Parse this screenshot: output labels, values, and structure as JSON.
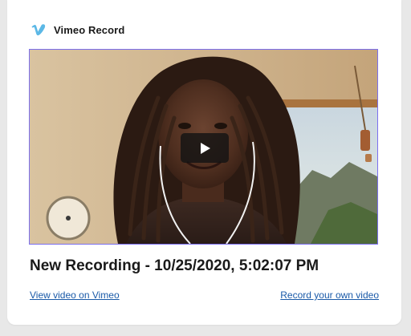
{
  "brand": {
    "name": "Vimeo Record",
    "icon": "vimeo-v-logo",
    "color": "#5cb8e6"
  },
  "video": {
    "thumbnail": "webcam recording thumbnail",
    "play_icon": "play-icon",
    "border_color": "#7b6ff0"
  },
  "recording": {
    "title": "New Recording - 10/25/2020, 5:02:07 PM"
  },
  "links": {
    "view_on_vimeo": "View video on Vimeo",
    "record_own": "Record your own video",
    "color": "#1a5aa8"
  }
}
